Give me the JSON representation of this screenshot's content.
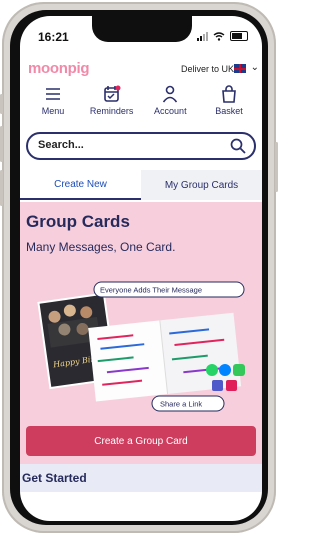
{
  "status": {
    "time": "16:21"
  },
  "brand": {
    "logo": "moonpig",
    "deliver_to": "Deliver to UK"
  },
  "nav": [
    {
      "label": "Menu",
      "icon": "menu-icon"
    },
    {
      "label": "Reminders",
      "icon": "calendar-icon"
    },
    {
      "label": "Account",
      "icon": "account-icon"
    },
    {
      "label": "Basket",
      "icon": "basket-icon"
    }
  ],
  "search": {
    "placeholder": "Search..."
  },
  "tabs": [
    {
      "label": "Create New",
      "active": true
    },
    {
      "label": "My Group Cards",
      "active": false
    }
  ],
  "hero": {
    "title": "Group Cards",
    "subtitle": "Many Messages, One Card.",
    "badge_everyone": "Everyone Adds Their Message",
    "badge_share": "Share a Link",
    "card_text": "Happy Birthday",
    "cta": "Create a Group Card"
  },
  "section": {
    "get_started": "Get Started"
  },
  "colors": {
    "accent": "#cf3d5e",
    "navy": "#2b2f6b",
    "hero_bg": "#f7cfdc",
    "logo": "#f08aa8"
  }
}
